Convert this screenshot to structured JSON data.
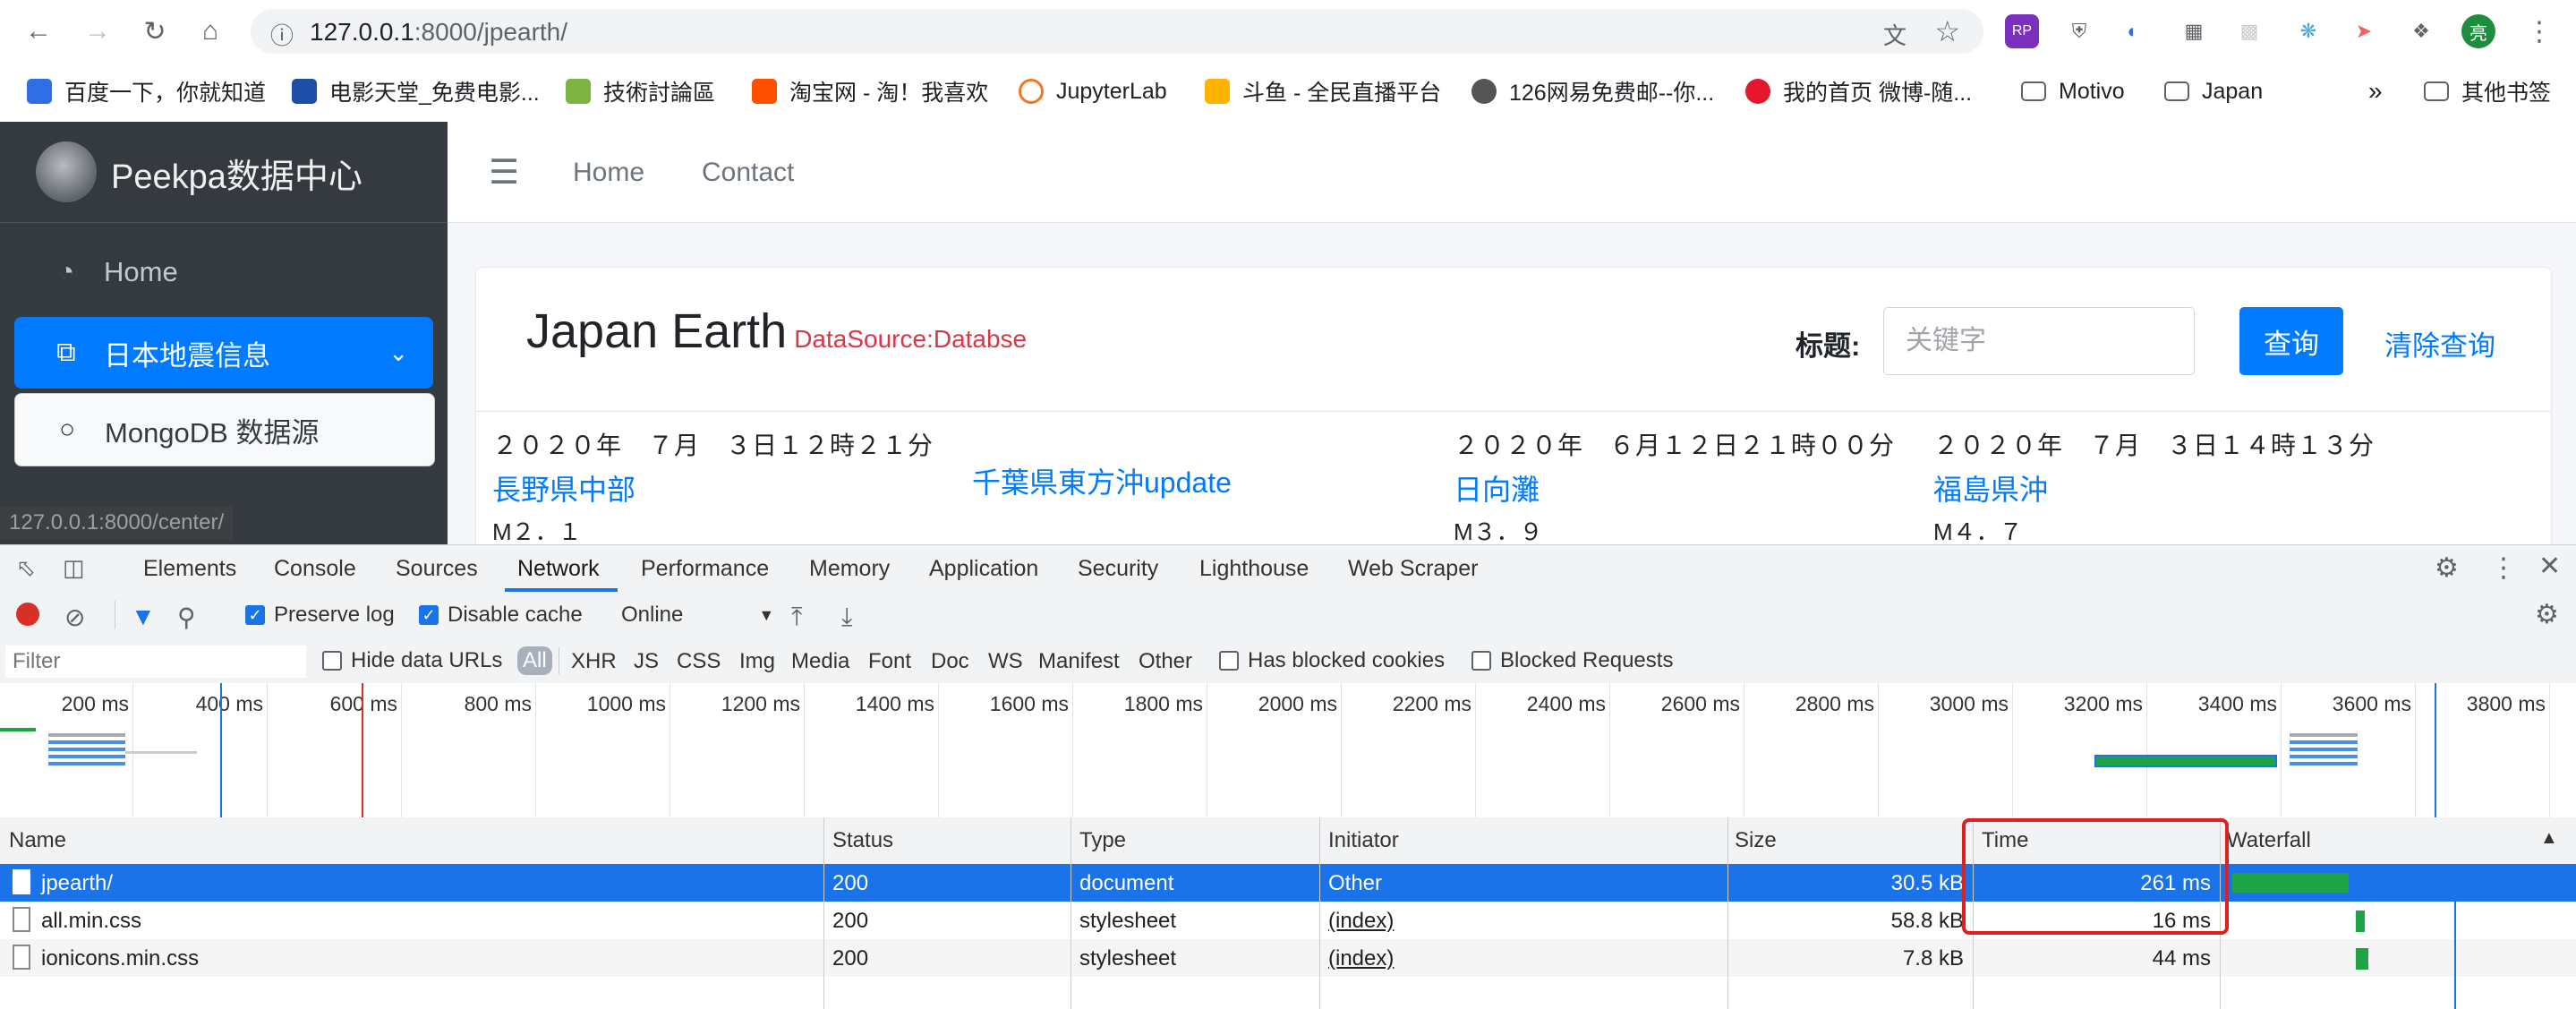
{
  "browser": {
    "url_host": "127.0.0.1",
    "url_rest": ":8000/jpearth/",
    "bookmarks": [
      "百度一下，你就知道",
      "电影天堂_免费电影...",
      "技術討論區",
      "淘宝网 - 淘！我喜欢",
      "JupyterLab",
      "斗鱼 - 全民直播平台",
      "126网易免费邮--你...",
      "我的首页 微博-随...",
      "Motivo",
      "Japan",
      "其他书签"
    ],
    "more_bookmarks": "»",
    "profile_initial": "亮"
  },
  "site": {
    "brand": "Peekpa数据中心",
    "nav": [
      "Home",
      "Contact"
    ],
    "sidebar": [
      "Home",
      "日本地震信息",
      "MongoDB 数据源"
    ],
    "status_url": "127.0.0.1:8000/center/"
  },
  "card": {
    "title": "Japan Earth",
    "subtitle": "DataSource:Databse",
    "search_label": "标题:",
    "search_placeholder": "关键字",
    "query_button": "查询",
    "clear_button": "清除查询"
  },
  "quakes": [
    {
      "datetime": "２０２０年　７月　３日１２時２１分",
      "location": "長野県中部",
      "mag": "M２．１"
    },
    {
      "datetime": "",
      "location": "千葉県東方沖update",
      "mag": ""
    },
    {
      "datetime": "２０２０年　６月１２日２１時００分",
      "location": "日向灘",
      "mag": "M３．９"
    },
    {
      "datetime": "２０２０年　７月　３日１４時１３分",
      "location": "福島県沖",
      "mag": "M４．７"
    }
  ],
  "devtools": {
    "tabs": [
      "Elements",
      "Console",
      "Sources",
      "Network",
      "Performance",
      "Memory",
      "Application",
      "Security",
      "Lighthouse",
      "Web Scraper"
    ],
    "active_tab": "Network",
    "preserve_log": "Preserve log",
    "disable_cache": "Disable cache",
    "throttle": "Online",
    "filter_placeholder": "Filter",
    "hide_data_urls": "Hide data URLs",
    "types": [
      "All",
      "XHR",
      "JS",
      "CSS",
      "Img",
      "Media",
      "Font",
      "Doc",
      "WS",
      "Manifest",
      "Other"
    ],
    "has_blocked_cookies": "Has blocked cookies",
    "blocked_requests": "Blocked Requests",
    "timeline_ticks": [
      "200 ms",
      "400 ms",
      "600 ms",
      "800 ms",
      "1000 ms",
      "1200 ms",
      "1400 ms",
      "1600 ms",
      "1800 ms",
      "2000 ms",
      "2200 ms",
      "2400 ms",
      "2600 ms",
      "2800 ms",
      "3000 ms",
      "3200 ms",
      "3400 ms",
      "3600 ms",
      "3800 ms"
    ],
    "columns": [
      "Name",
      "Status",
      "Type",
      "Initiator",
      "Size",
      "Time",
      "Waterfall"
    ],
    "rows": [
      {
        "name": "jpearth/",
        "status": "200",
        "type": "document",
        "initiator": "Other",
        "size": "30.5 kB",
        "time": "261 ms"
      },
      {
        "name": "all.min.css",
        "status": "200",
        "type": "stylesheet",
        "initiator": "(index)",
        "size": "58.8 kB",
        "time": "16 ms"
      },
      {
        "name": "ionicons.min.css",
        "status": "200",
        "type": "stylesheet",
        "initiator": "(index)",
        "size": "7.8 kB",
        "time": "44 ms"
      }
    ],
    "colors": {
      "accent": "#1a73e8",
      "highlight": "#e02020",
      "record": "#d93025"
    }
  }
}
